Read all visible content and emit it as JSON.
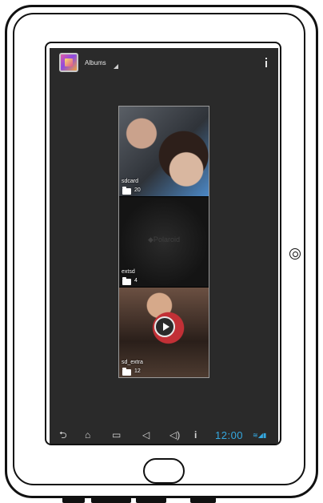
{
  "action_bar": {
    "title": "Albums",
    "icons": [
      "gallery-app-icon",
      "dropdown-triangle-icon",
      "info-icon"
    ]
  },
  "albums": [
    {
      "name": "sdcard",
      "count": "20",
      "thumbnail": "people-photo"
    },
    {
      "name": "extsd",
      "count": "4",
      "thumbnail": "polaroid-watermark",
      "watermark": "◆Polaroid"
    },
    {
      "name": "sd_extra",
      "count": "12",
      "thumbnail": "video-photo"
    }
  ],
  "nav_bar": {
    "icons": [
      "back-icon",
      "home-icon",
      "recent-apps-icon",
      "volume-down-icon",
      "volume-up-icon",
      "menu-icon"
    ],
    "clock": "12:00",
    "status_icons": [
      "wifi-icon",
      "signal-icon",
      "battery-icon"
    ],
    "status_color": "#35a8e0"
  },
  "colors": {
    "screen_bg": "#2a2a2a",
    "accent": "#35a8e0"
  }
}
